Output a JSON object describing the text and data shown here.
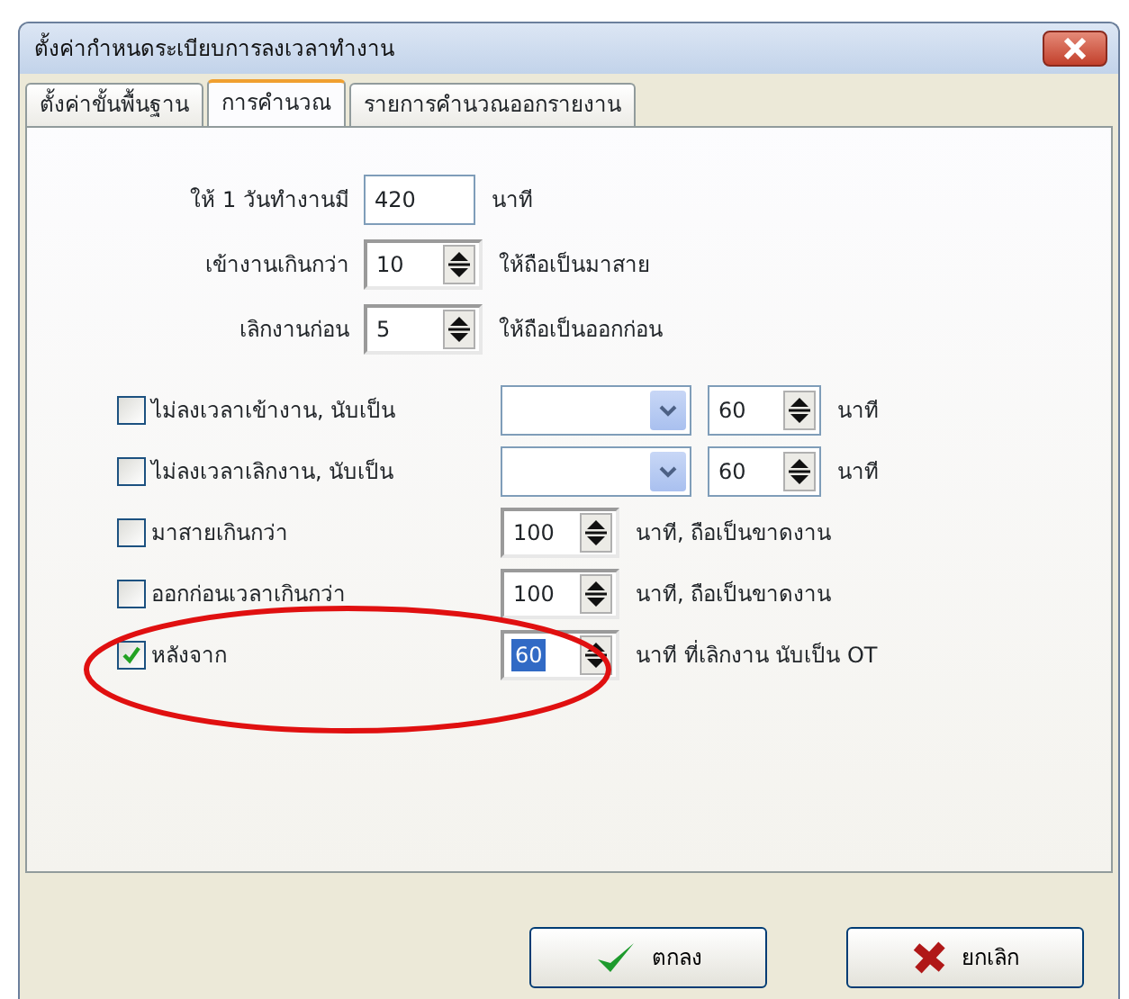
{
  "window": {
    "title": "ตั้งค่ากำหนดระเบียบการลงเวลาทำงาน"
  },
  "tabs": [
    {
      "label": "ตั้งค่าขั้นพื้นฐาน",
      "selected": false
    },
    {
      "label": "การคำนวณ",
      "selected": true
    },
    {
      "label": "รายการคำนวณออกรายงาน",
      "selected": false
    }
  ],
  "rows": [
    {
      "kind": "number",
      "label": "ให้ 1 วันทำงานมี",
      "value": "420",
      "unit": "นาที"
    },
    {
      "kind": "spin",
      "label": "เข้างานเกินกว่า",
      "value": "10",
      "unit": "ให้ถือเป็นมาสาย"
    },
    {
      "kind": "spin",
      "label": "เลิกงานก่อน",
      "value": "5",
      "unit": "ให้ถือเป็นออกก่อน"
    },
    {
      "kind": "check_combo",
      "label": "ไม่ลงเวลาเข้างาน, นับเป็น",
      "checked": false,
      "value": "60",
      "unit": "นาที"
    },
    {
      "kind": "check_combo",
      "label": "ไม่ลงเวลาเลิกงาน, นับเป็น",
      "checked": false,
      "value": "60",
      "unit": "นาที"
    },
    {
      "kind": "check_spin",
      "label": "มาสายเกินกว่า",
      "checked": false,
      "value": "100",
      "unit": "นาที, ถือเป็นขาดงาน",
      "highlighted": false
    },
    {
      "kind": "check_spin",
      "label": "ออกก่อนเวลาเกินกว่า",
      "checked": false,
      "value": "100",
      "unit": "นาที, ถือเป็นขาดงาน",
      "highlighted": false
    },
    {
      "kind": "check_spin",
      "label": "หลังจาก",
      "checked": true,
      "value": "60",
      "unit": "นาที ที่เลิกงาน นับเป็น OT",
      "highlighted": true
    }
  ],
  "buttons": [
    {
      "kind": "ok",
      "label": "ตกลง"
    },
    {
      "kind": "cancel",
      "label": "ยกเลิก"
    }
  ]
}
